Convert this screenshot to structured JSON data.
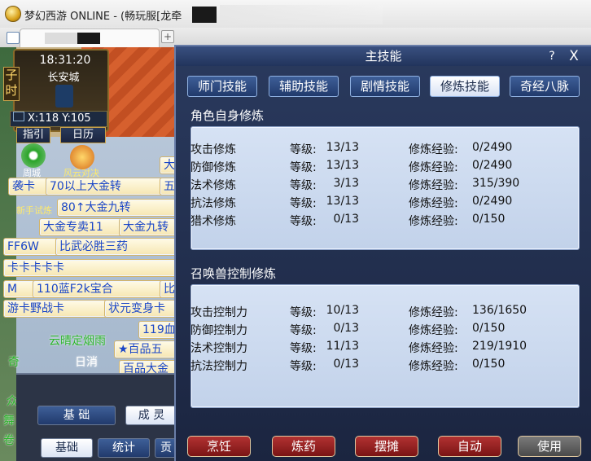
{
  "window": {
    "title": "梦幻西游 ONLINE - (畅玩服[龙牵",
    "tab_close": "×",
    "tab_new": "+"
  },
  "hud": {
    "time": "18:31:20",
    "city": "长安城",
    "hour": "子时",
    "coords": "X:118 Y:105",
    "buttons": [
      "指引",
      "日历"
    ]
  },
  "left_labels": [
    "大",
    "袭卡",
    "70以上大金转",
    "五",
    "80↑大金九转",
    "大金专卖11",
    "大金九转",
    "FF6W",
    "比武必胜三药",
    "卡卡卡卡卡",
    "M",
    "110蓝F2k宝合",
    "比",
    "游卡野战卡",
    "状元变身卡",
    "119血",
    "★百品五",
    "百品大金",
    "云晴定烟雨",
    "日消",
    "周城",
    "风云对决",
    "新手试炼",
    "奇",
    "众",
    "舞",
    "卷"
  ],
  "left_panel": {
    "tab_basic": "基 础",
    "tab_growth": "成 灵",
    "sub_basic": "基础",
    "sub_stats": "统计",
    "sub_more": "贡"
  },
  "panel": {
    "title": "主技能",
    "help": "?",
    "close": "X",
    "tabs": [
      "师门技能",
      "辅助技能",
      "剧情技能",
      "修炼技能",
      "奇经八脉"
    ],
    "active_tab": "修炼技能",
    "section_role": "角色自身修炼",
    "section_pet": "召唤兽控制修炼",
    "level_label": "等级:",
    "exp_label": "修炼经验:",
    "role_rows": [
      {
        "name": "攻击修炼",
        "level": "13/13",
        "exp": "0/2490"
      },
      {
        "name": "防御修炼",
        "level": "13/13",
        "exp": "0/2490"
      },
      {
        "name": "法术修炼",
        "level": "3/13",
        "exp": "315/390"
      },
      {
        "name": "抗法修炼",
        "level": "13/13",
        "exp": "0/2490"
      },
      {
        "name": "猎术修炼",
        "level": "0/13",
        "exp": "0/150"
      }
    ],
    "pet_rows": [
      {
        "name": "攻击控制力",
        "level": "10/13",
        "exp": "136/1650"
      },
      {
        "name": "防御控制力",
        "level": "0/13",
        "exp": "0/150"
      },
      {
        "name": "法术控制力",
        "level": "11/13",
        "exp": "219/1910"
      },
      {
        "name": "抗法控制力",
        "level": "0/13",
        "exp": "0/150"
      }
    ],
    "bottom_buttons": [
      "烹饪",
      "炼药",
      "摆摊",
      "自动",
      "使用"
    ]
  },
  "colors": {
    "panel_bg": "#1b2540",
    "box_bg": "#c2d2ea",
    "button_red": "#b23232",
    "label_blue": "#1a46c8"
  }
}
